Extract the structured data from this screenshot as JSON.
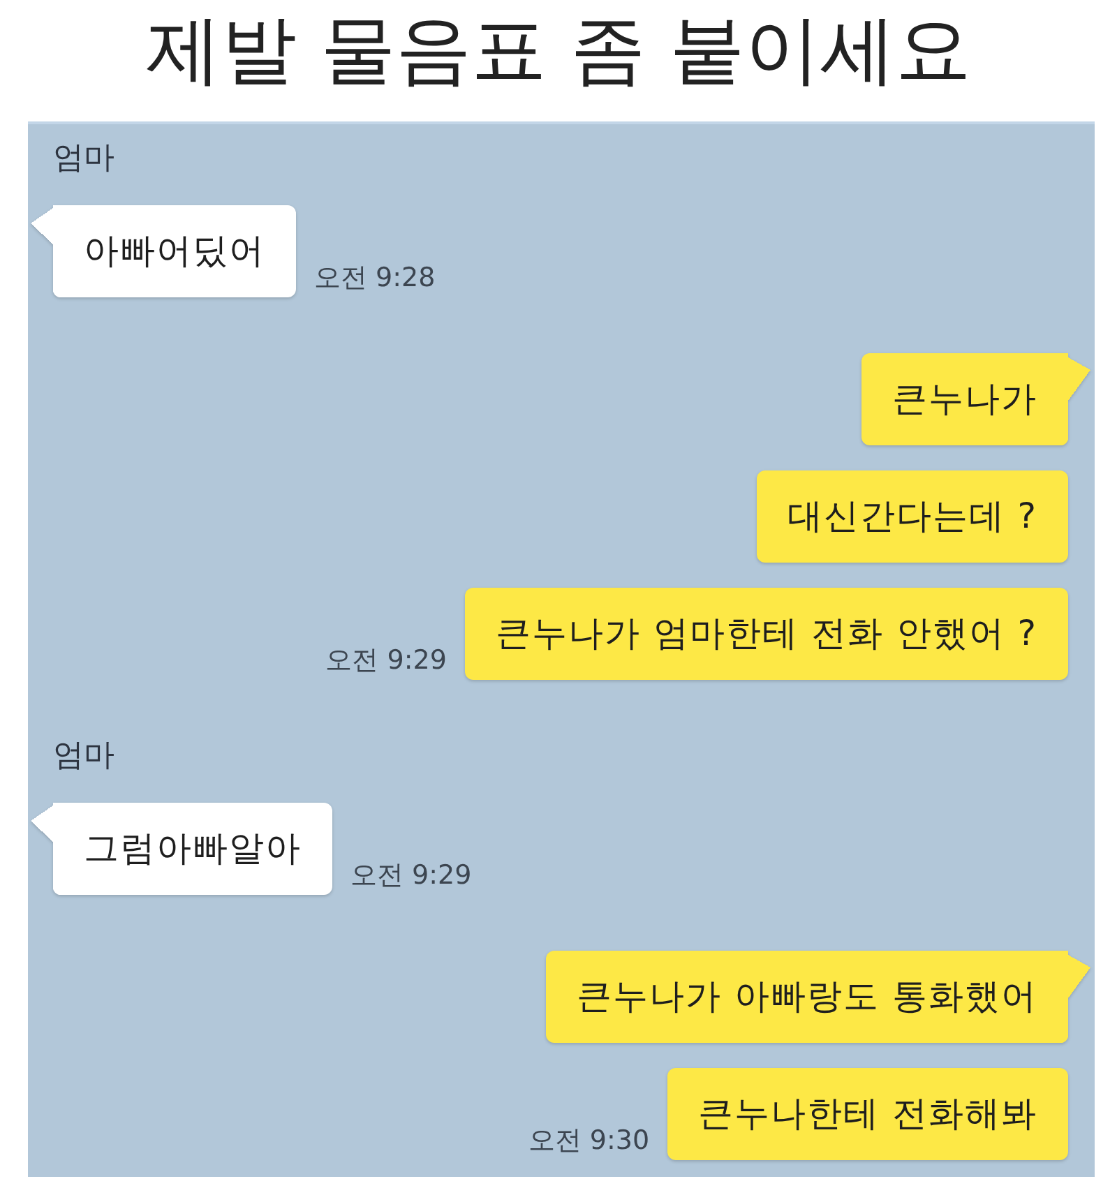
{
  "title": "제발 물음표 좀 붙이세요",
  "chat": {
    "groups": [
      {
        "kind": "received",
        "sender": "엄마",
        "messages": [
          {
            "text": "아빠어딨어",
            "time": "오전 9:28"
          }
        ]
      },
      {
        "kind": "sent",
        "messages": [
          {
            "text": "큰누나가"
          },
          {
            "text": "대신간다는데 ?"
          },
          {
            "text": "큰누나가 엄마한테 전화 안했어 ?",
            "time": "오전 9:29"
          }
        ]
      },
      {
        "kind": "received",
        "sender": "엄마",
        "messages": [
          {
            "text": "그럼아빠알아",
            "time": "오전 9:29"
          }
        ]
      },
      {
        "kind": "sent",
        "messages": [
          {
            "text": "큰누나가 아빠랑도 통화했어"
          },
          {
            "text": "큰누나한테 전화해봐",
            "time": "오전 9:30"
          }
        ]
      }
    ]
  }
}
